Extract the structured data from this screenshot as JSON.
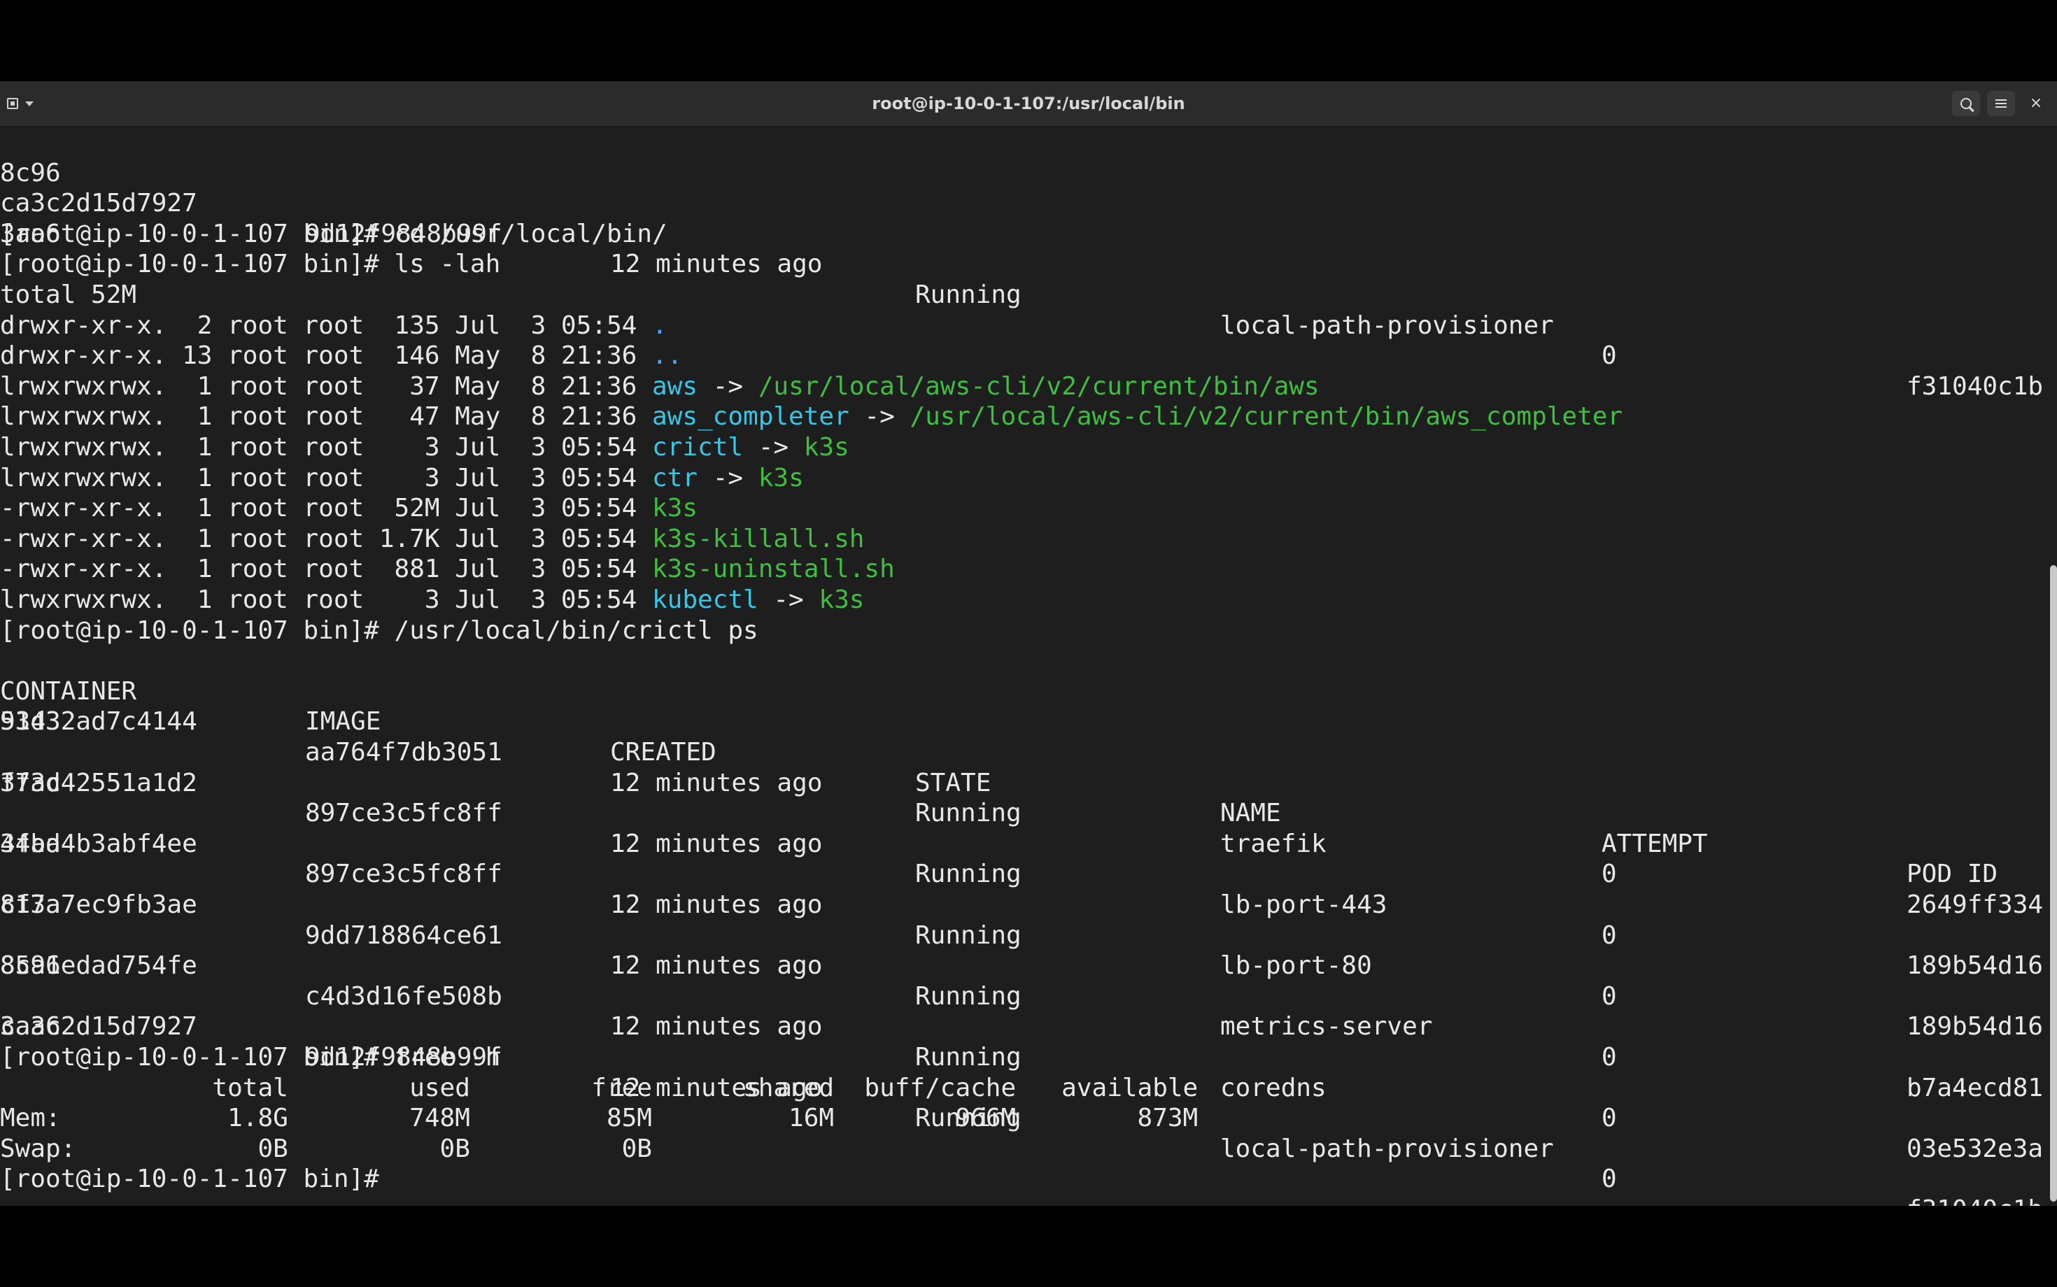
{
  "window": {
    "title": "root@ip-10-0-1-107:/usr/local/bin",
    "icons": [
      "new-tab-icon",
      "chevron-down-icon",
      "search-icon",
      "menu-icon",
      "close-icon"
    ],
    "close_glyph": "×"
  },
  "colors": {
    "background": "#1e1e1e",
    "text": "#e8e8e8",
    "directory": "#4aa3ff",
    "symlink": "#35c7e8",
    "executable": "#3fbf3f"
  },
  "terminal": {
    "top_rows": [
      {
        "cols": [
          "8c96"
        ]
      },
      {
        "cols": [
          "ca3c2d15d7927",
          "9d12f9848b99f",
          "12 minutes ago",
          "Running",
          "local-path-provisioner",
          "0",
          "f31040c1b"
        ]
      },
      {
        "cols": [
          "3aa6"
        ]
      }
    ],
    "cmd_cd": "[root@ip-10-0-1-107 bin]# cd /usr/local/bin/",
    "cmd_ls": "[root@ip-10-0-1-107 bin]# ls -lah",
    "ls_total": "total 52M",
    "ls_entries": [
      {
        "meta": "drwxr-xr-x.  2 root root  135 Jul  3 05:54 ",
        "name": ".",
        "arrow": "",
        "target": ""
      },
      {
        "meta": "drwxr-xr-x. 13 root root  146 May  8 21:36 ",
        "name": "..",
        "arrow": "",
        "target": ""
      },
      {
        "meta": "lrwxrwxrwx.  1 root root   37 May  8 21:36 ",
        "name": "aws",
        "arrow": " -> ",
        "target": "/usr/local/aws-cli/v2/current/bin/aws"
      },
      {
        "meta": "lrwxrwxrwx.  1 root root   47 May  8 21:36 ",
        "name": "aws_completer",
        "arrow": " -> ",
        "target": "/usr/local/aws-cli/v2/current/bin/aws_completer"
      },
      {
        "meta": "lrwxrwxrwx.  1 root root    3 Jul  3 05:54 ",
        "name": "crictl",
        "arrow": " -> ",
        "target": "k3s"
      },
      {
        "meta": "lrwxrwxrwx.  1 root root    3 Jul  3 05:54 ",
        "name": "ctr",
        "arrow": " -> ",
        "target": "k3s"
      },
      {
        "meta": "-rwxr-xr-x.  1 root root  52M Jul  3 05:54 ",
        "name": "k3s",
        "arrow": "",
        "target": ""
      },
      {
        "meta": "-rwxr-xr-x.  1 root root 1.7K Jul  3 05:54 ",
        "name": "k3s-killall.sh",
        "arrow": "",
        "target": ""
      },
      {
        "meta": "-rwxr-xr-x.  1 root root  881 Jul  3 05:54 ",
        "name": "k3s-uninstall.sh",
        "arrow": "",
        "target": ""
      },
      {
        "meta": "lrwxrwxrwx.  1 root root    3 Jul  3 05:54 ",
        "name": "kubectl",
        "arrow": " -> ",
        "target": "k3s"
      }
    ],
    "cmd_crictl": "[root@ip-10-0-1-107 bin]# /usr/local/bin/crictl ps",
    "crictl_headers": [
      "CONTAINER",
      "IMAGE",
      "CREATED",
      "STATE",
      "NAME",
      "ATTEMPT",
      "POD ID"
    ],
    "crictl_rows": [
      {
        "cols": [
          "53d32ad7c4144",
          "aa764f7db3051",
          "12 minutes ago",
          "Running",
          "traefik",
          "0",
          "2649ff334"
        ],
        "wrap": "9143"
      },
      {
        "cols": [
          "f73c42551a1d2",
          "897ce3c5fc8ff",
          "12 minutes ago",
          "Running",
          "lb-port-443",
          "0",
          "189b54d16"
        ],
        "wrap": "3fad"
      },
      {
        "cols": [
          "44ba4b3abf4ee",
          "897ce3c5fc8ff",
          "12 minutes ago",
          "Running",
          "lb-port-80",
          "0",
          "189b54d16"
        ],
        "wrap": "3fad"
      },
      {
        "cols": [
          "817a7ec9fb3ae",
          "9dd718864ce61",
          "12 minutes ago",
          "Running",
          "metrics-server",
          "0",
          "b7a4ecd81"
        ],
        "wrap": "cf3a"
      },
      {
        "cols": [
          "85a1edad754fe",
          "c4d3d16fe508b",
          "12 minutes ago",
          "Running",
          "coredns",
          "0",
          "03e532e3a"
        ],
        "wrap": "8c96"
      },
      {
        "cols": [
          "ca3c2d15d7927",
          "9d12f9848b99f",
          "12 minutes ago",
          "Running",
          "local-path-provisioner",
          "0",
          "f31040c1b"
        ],
        "wrap": "3aa6"
      }
    ],
    "cmd_free": "[root@ip-10-0-1-107 bin]# free -h",
    "free_header": "              total        used        free      shared  buff/cache   available",
    "free_mem": "Mem:           1.8G        748M         85M         16M        966M        873M",
    "free_swap": "Swap:            0B          0B          0B",
    "prompt": "[root@ip-10-0-1-107 bin]# "
  }
}
